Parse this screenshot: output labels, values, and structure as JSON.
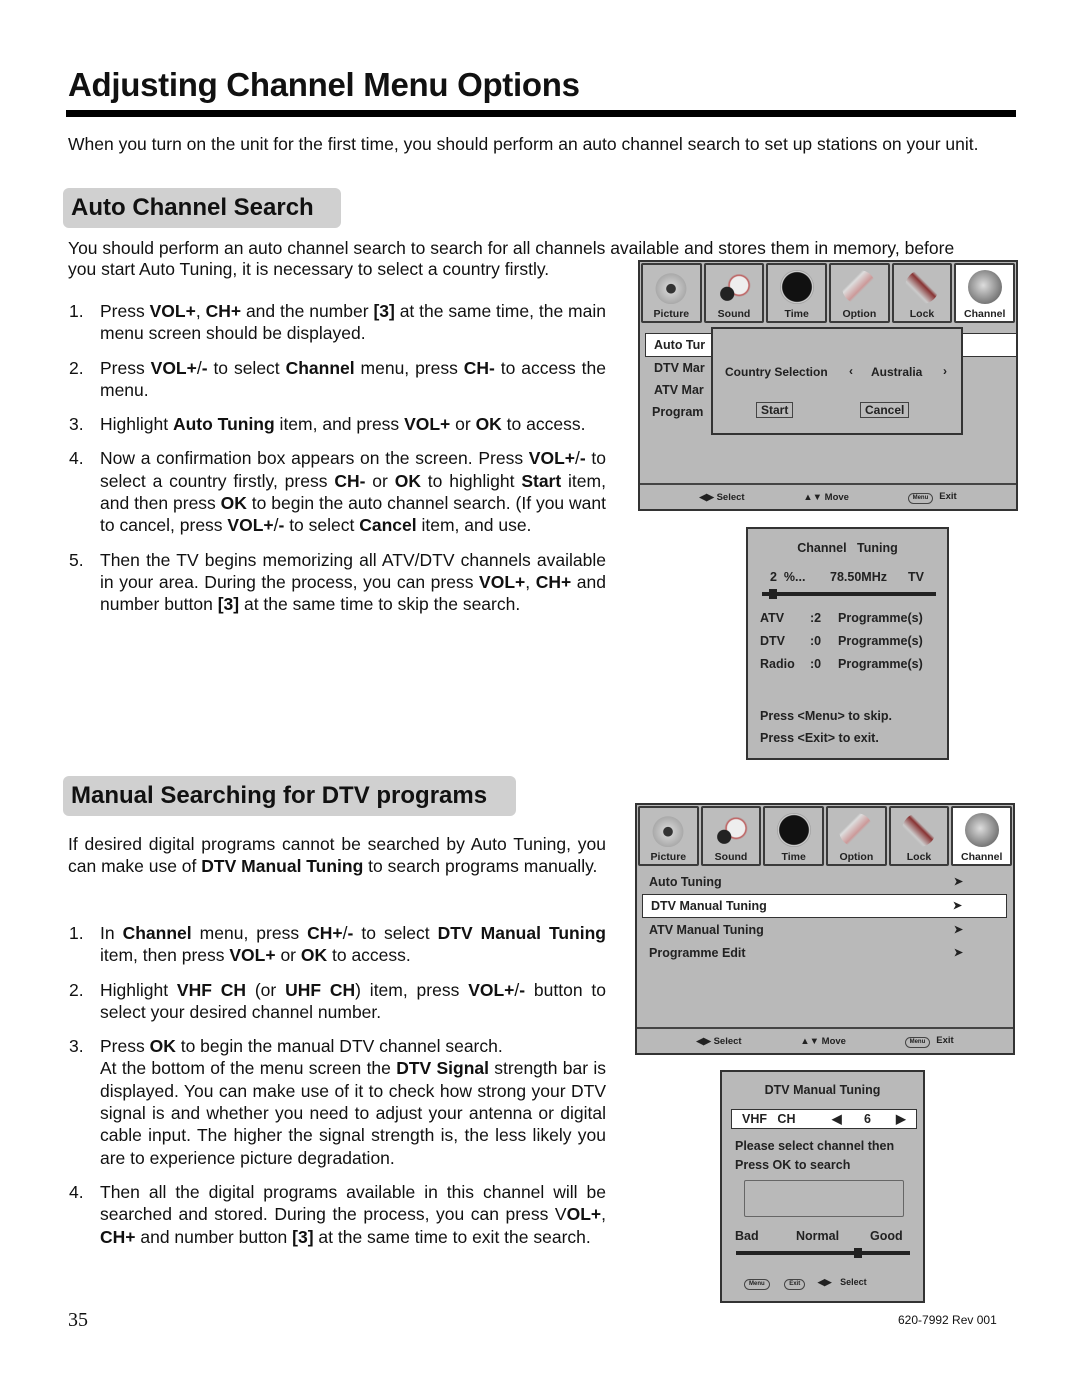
{
  "page": {
    "title": "Adjusting Channel Menu Options",
    "intro": "When you turn on the unit for the first time, you should perform an auto channel search to set up stations on your unit.",
    "page_number": "35",
    "doc_code": "620-7992 Rev 001"
  },
  "auto_search": {
    "heading": "Auto Channel Search",
    "intro_line1": "You should perform an auto channel search to search for all channels available and stores them in memory, before",
    "intro_line2": "you start Auto Tuning, it is necessary to select a country firstly.",
    "steps": [
      {
        "num": "1.",
        "html": "Press <b>VOL+</b>, <b>CH+</b> and the number <b>[3]</b> at the same time, the main menu screen should be displayed."
      },
      {
        "num": "2.",
        "html": "Press <b>VOL+</b>/<b>-</b> to select <b>Channel</b> menu, press <b>CH-</b> to access the menu."
      },
      {
        "num": "3.",
        "html": "Highlight <b>Auto Tuning</b> item, and press <b>VOL+</b> or <b>OK</b> to access."
      },
      {
        "num": "4.",
        "html": "Now a confirmation box appears on the screen. Press <b>VOL+</b>/<b>-</b> to select a country firstly, press <b>CH-</b> or <b>OK</b> to highlight <b>Start</b> item, and then press <b>OK</b> to begin the auto channel search. (If you want to cancel, press <b>VOL+</b>/<b>-</b> to select <b>Cancel</b> item, and use."
      },
      {
        "num": "5.",
        "html": "Then the TV begins memorizing all ATV/DTV channels available in your area. During the process, you can press <b>VOL+</b>, <b>CH+</b> and number button <b>[3]</b> at the same time to skip the search."
      }
    ]
  },
  "manual_search": {
    "heading": "Manual Searching for DTV programs",
    "intro_html": "If desired digital programs cannot be searched by Auto Tuning, you can make use of <b>DTV Manual Tuning</b> to search programs manually.",
    "steps": [
      {
        "num": "1.",
        "html": "In <b>Channel</b> menu, press <b>CH+</b>/<b>-</b> to select <b>DTV Manual Tuning</b> item, then press <b>VOL+</b> or <b>OK</b> to access."
      },
      {
        "num": "2.",
        "html": "Highlight <b>VHF CH</b> (or <b>UHF CH</b>) item, press <b>VOL+</b>/<b>-</b> button to select your desired channel number."
      },
      {
        "num": "3.",
        "html": "Press <b>OK</b> to begin the manual DTV channel search.<br>At the bottom of the menu screen the <b>DTV Signal</b> strength bar is displayed. You can make use of it to check how strong your DTV signal is and whether you need to adjust your antenna or digital cable input. The higher the signal strength is, the less likely you are to experience picture degradation."
      },
      {
        "num": "4.",
        "html": "Then all the digital programs available in this channel will be searched and stored. During the process, you can press V<b>OL+</b>, <b>CH+</b> and number button <b>[3]</b> at the same time to exit the search."
      }
    ]
  },
  "tv_tabs": [
    {
      "label": "Picture",
      "icon": "camera-icon"
    },
    {
      "label": "Sound",
      "icon": "headphones-icon"
    },
    {
      "label": "Time",
      "icon": "clock-icon"
    },
    {
      "label": "Option",
      "icon": "gear-tool-icon"
    },
    {
      "label": "Lock",
      "icon": "lock-icon"
    },
    {
      "label": "Channel",
      "icon": "globe-icon"
    }
  ],
  "tv_footer": {
    "select": "Select",
    "move": "Move",
    "menu_key": "Menu",
    "exit": "Exit"
  },
  "screen1": {
    "menu_items": [
      "Auto Tur",
      "DTV Mar",
      "ATV Mar",
      "Program"
    ],
    "dialog": {
      "country_label": "Country  Selection",
      "country_value": "Australia",
      "start": "Start",
      "cancel": "Cancel"
    }
  },
  "channel_tuning": {
    "title": "Channel   Tuning",
    "percent": "2  %...",
    "frequency": "78.50MHz",
    "type": "TV",
    "progress": 0.04,
    "rows": [
      {
        "label": "ATV",
        "count": ":2",
        "unit": "Programme(s)"
      },
      {
        "label": "DTV",
        "count": ":0",
        "unit": "Programme(s)"
      },
      {
        "label": "Radio",
        "count": ":0",
        "unit": "Programme(s)"
      }
    ],
    "hint1": "Press <Menu> to skip.",
    "hint2": "Press <Exit> to exit."
  },
  "screen2": {
    "menu_items": [
      "Auto Tuning",
      "DTV Manual Tuning",
      "ATV Manual Tuning",
      "Programme Edit"
    ],
    "selected_index": 1
  },
  "dtv_manual": {
    "title": "DTV Manual Tuning",
    "band": "VHF   CH",
    "channel": "6",
    "msg1": "Please select channel then",
    "msg2": "Press OK to search",
    "bad": "Bad",
    "normal": "Normal",
    "good": "Good",
    "signal": 0.68,
    "menu_key": "Menu",
    "exit_key": "Exit",
    "select": "Select"
  }
}
